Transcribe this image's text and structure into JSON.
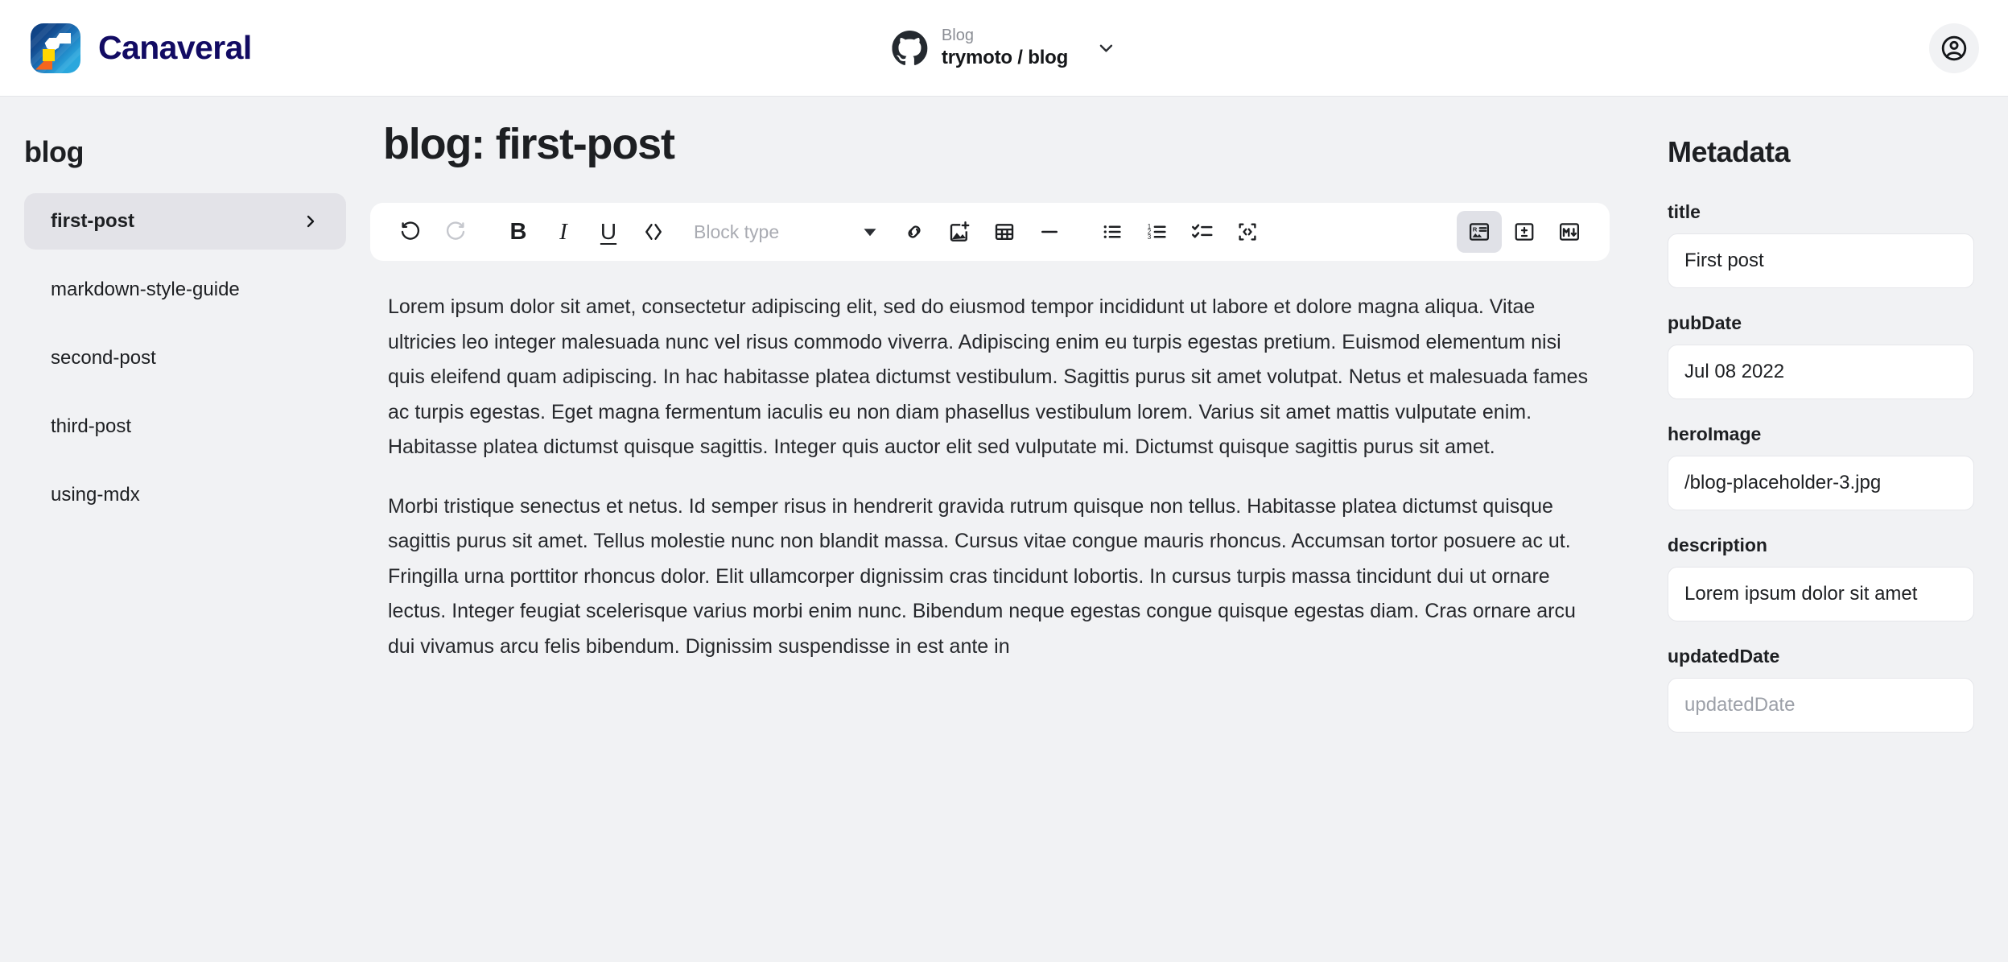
{
  "header": {
    "brand_name": "Canaveral",
    "brand_logo_icon": "canaveral-rocket-logo",
    "repo": {
      "provider_icon": "github-icon",
      "kind": "Blog",
      "name": "trymoto / blog",
      "caret_icon": "chevron-down-icon"
    },
    "account_icon": "account-circle-icon"
  },
  "sidebar": {
    "title": "blog",
    "items": [
      {
        "label": "first-post",
        "active": true,
        "chevron_icon": "chevron-right-icon"
      },
      {
        "label": "markdown-style-guide",
        "active": false
      },
      {
        "label": "second-post",
        "active": false
      },
      {
        "label": "third-post",
        "active": false
      },
      {
        "label": "using-mdx",
        "active": false
      }
    ]
  },
  "editor": {
    "doc_title": "blog: first-post",
    "toolbar": {
      "undo_label": "Undo",
      "redo_label": "Redo",
      "bold_label": "B",
      "italic_label": "I",
      "underline_label": "U",
      "code_label": "Inline code",
      "blocktype_placeholder": "Block type",
      "blocktype_value": "",
      "link_label": "Insert link",
      "image_label": "Insert image",
      "table_label": "Insert table",
      "hr_label": "Horizontal rule",
      "bullet_list_label": "Bulleted list",
      "numbered_list_label": "Numbered list",
      "checklist_label": "Check list",
      "codeblock_label": "Code block",
      "view_rich_label": "Rich text view",
      "view_diff_label": "Diff view",
      "view_markdown_label": "Markdown view",
      "active_view": "Rich text view"
    },
    "paragraphs": [
      "Lorem ipsum dolor sit amet, consectetur adipiscing elit, sed do eiusmod tempor incididunt ut labore et dolore magna aliqua. Vitae ultricies leo integer malesuada nunc vel risus commodo viverra. Adipiscing enim eu turpis egestas pretium. Euismod elementum nisi quis eleifend quam adipiscing. In hac habitasse platea dictumst vestibulum. Sagittis purus sit amet volutpat. Netus et malesuada fames ac turpis egestas. Eget magna fermentum iaculis eu non diam phasellus vestibulum lorem. Varius sit amet mattis vulputate enim. Habitasse platea dictumst quisque sagittis. Integer quis auctor elit sed vulputate mi. Dictumst quisque sagittis purus sit amet.",
      "Morbi tristique senectus et netus. Id semper risus in hendrerit gravida rutrum quisque non tellus. Habitasse platea dictumst quisque sagittis purus sit amet. Tellus molestie nunc non blandit massa. Cursus vitae congue mauris rhoncus. Accumsan tortor posuere ac ut. Fringilla urna porttitor rhoncus dolor. Elit ullamcorper dignissim cras tincidunt lobortis. In cursus turpis massa tincidunt dui ut ornare lectus. Integer feugiat scelerisque varius morbi enim nunc. Bibendum neque egestas congue quisque egestas diam. Cras ornare arcu dui vivamus arcu felis bibendum. Dignissim suspendisse in est ante in"
    ]
  },
  "metadata": {
    "title": "Metadata",
    "fields": [
      {
        "label": "title",
        "value": "First post",
        "placeholder": "title"
      },
      {
        "label": "pubDate",
        "value": "Jul 08 2022",
        "placeholder": "pubDate"
      },
      {
        "label": "heroImage",
        "value": "/blog-placeholder-3.jpg",
        "placeholder": "heroImage"
      },
      {
        "label": "description",
        "value": "Lorem ipsum dolor sit amet",
        "placeholder": "description"
      },
      {
        "label": "updatedDate",
        "value": "",
        "placeholder": "updatedDate"
      }
    ]
  },
  "colors": {
    "page_bg": "#f1f2f4",
    "card_bg": "#ffffff",
    "brand_navy": "#120b63",
    "active_nav_bg": "#e3e3e8",
    "text": "#1d1f22",
    "muted_text": "#9ca0a8",
    "border": "#e5e6ea"
  }
}
